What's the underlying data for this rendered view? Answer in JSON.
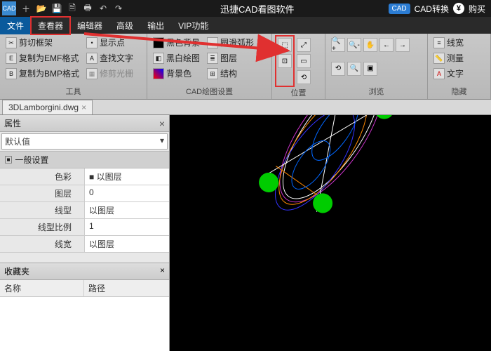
{
  "title": "迅捷CAD看图软件",
  "titlebar_right": {
    "cad_convert": "CAD转换",
    "buy": "购买"
  },
  "menus": [
    "文件",
    "查看器",
    "编辑器",
    "高级",
    "输出",
    "VIP功能"
  ],
  "ribbon": {
    "tools": {
      "label": "工具",
      "items": [
        "剪切框架",
        "复制为EMF格式",
        "复制为BMP格式",
        "显示点",
        "查找文字",
        "修剪光栅"
      ]
    },
    "cad_settings": {
      "label": "CAD绘图设置",
      "items": [
        "黑色背景",
        "黑白绘图",
        "背景色",
        "圆滑弧形",
        "图层",
        "结构"
      ]
    },
    "position": {
      "label": "位置"
    },
    "browse": {
      "label": "浏览"
    },
    "hide": {
      "label": "隐藏",
      "items": [
        "线宽",
        "测量",
        "文字"
      ]
    }
  },
  "tab": {
    "filename": "3DLamborgini.dwg"
  },
  "props": {
    "title": "属性",
    "default": "默认值",
    "group": "一般设置",
    "rows": [
      {
        "k": "色彩",
        "v": "■ 以图层"
      },
      {
        "k": "图层",
        "v": "0"
      },
      {
        "k": "线型",
        "v": "以图层"
      },
      {
        "k": "线型比例",
        "v": "1"
      },
      {
        "k": "线宽",
        "v": "以图层"
      }
    ]
  },
  "fav": {
    "title": "收藏夹",
    "cols": [
      "名称",
      "路径"
    ]
  }
}
